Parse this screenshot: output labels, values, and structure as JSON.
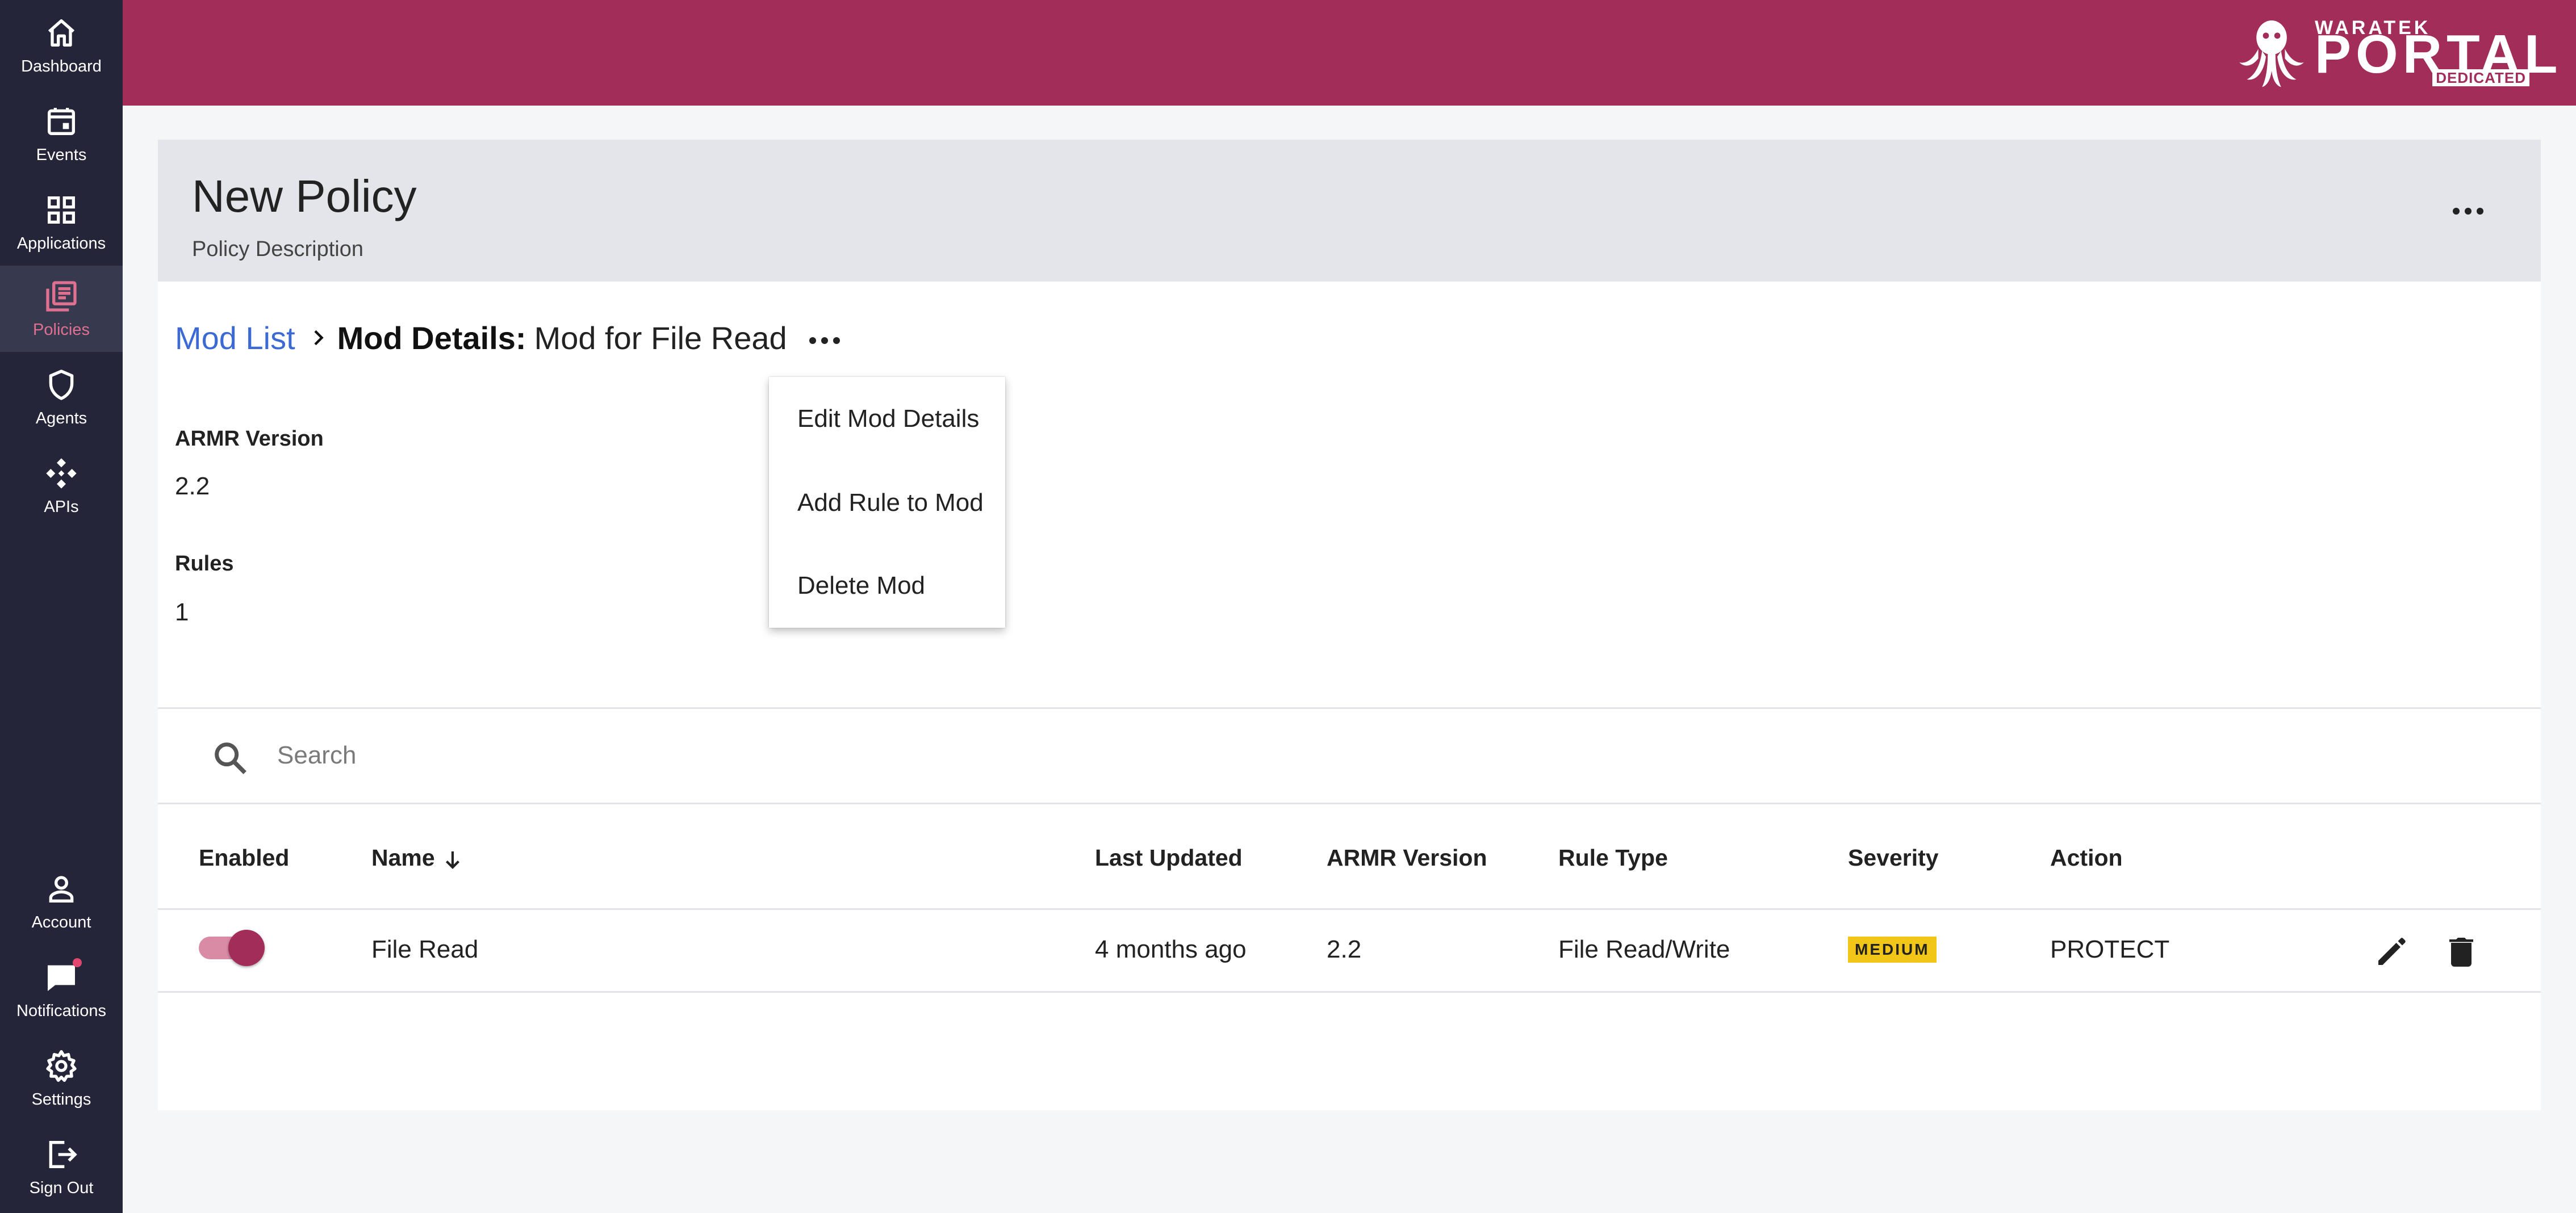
{
  "sidebar": {
    "items": [
      {
        "label": "Dashboard",
        "icon": "home-icon"
      },
      {
        "label": "Events",
        "icon": "calendar-icon"
      },
      {
        "label": "Applications",
        "icon": "grid-icon"
      },
      {
        "label": "Policies",
        "icon": "policies-icon",
        "active": true
      },
      {
        "label": "Agents",
        "icon": "shield-icon"
      },
      {
        "label": "APIs",
        "icon": "api-icon"
      }
    ],
    "bottom_items": [
      {
        "label": "Account",
        "icon": "person-icon"
      },
      {
        "label": "Notifications",
        "icon": "chat-icon",
        "has_dot": true
      },
      {
        "label": "Settings",
        "icon": "gear-icon"
      },
      {
        "label": "Sign Out",
        "icon": "sign-out-icon"
      }
    ]
  },
  "topbar": {
    "logo": {
      "small": "WARATEK",
      "big": "PORTAL",
      "tag": "DEDICATED"
    },
    "color": "#a22d59"
  },
  "policy": {
    "title": "New Policy",
    "description": "Policy Description"
  },
  "breadcrumb": {
    "link": "Mod List",
    "current_label": "Mod Details:",
    "current_name": "Mod for File Read"
  },
  "mod": {
    "armr_version_label": "ARMR Version",
    "armr_version": "2.2",
    "rules_label": "Rules",
    "rules_count": "1"
  },
  "menu": {
    "items": [
      "Edit Mod Details",
      "Add Rule to Mod",
      "Delete Mod"
    ]
  },
  "search": {
    "placeholder": "Search"
  },
  "table": {
    "headers": {
      "enabled": "Enabled",
      "name": "Name",
      "last_updated": "Last Updated",
      "armr_version": "ARMR Version",
      "rule_type": "Rule Type",
      "severity": "Severity",
      "action": "Action"
    },
    "rows": [
      {
        "enabled": true,
        "name": "File Read",
        "last_updated": "4 months ago",
        "armr_version": "2.2",
        "rule_type": "File Read/Write",
        "severity": "MEDIUM",
        "action": "PROTECT"
      }
    ]
  },
  "colors": {
    "accent": "#a22d59",
    "link": "#3b6ad4",
    "sidebar": "#242538",
    "severity_medium": "#f2c617"
  }
}
